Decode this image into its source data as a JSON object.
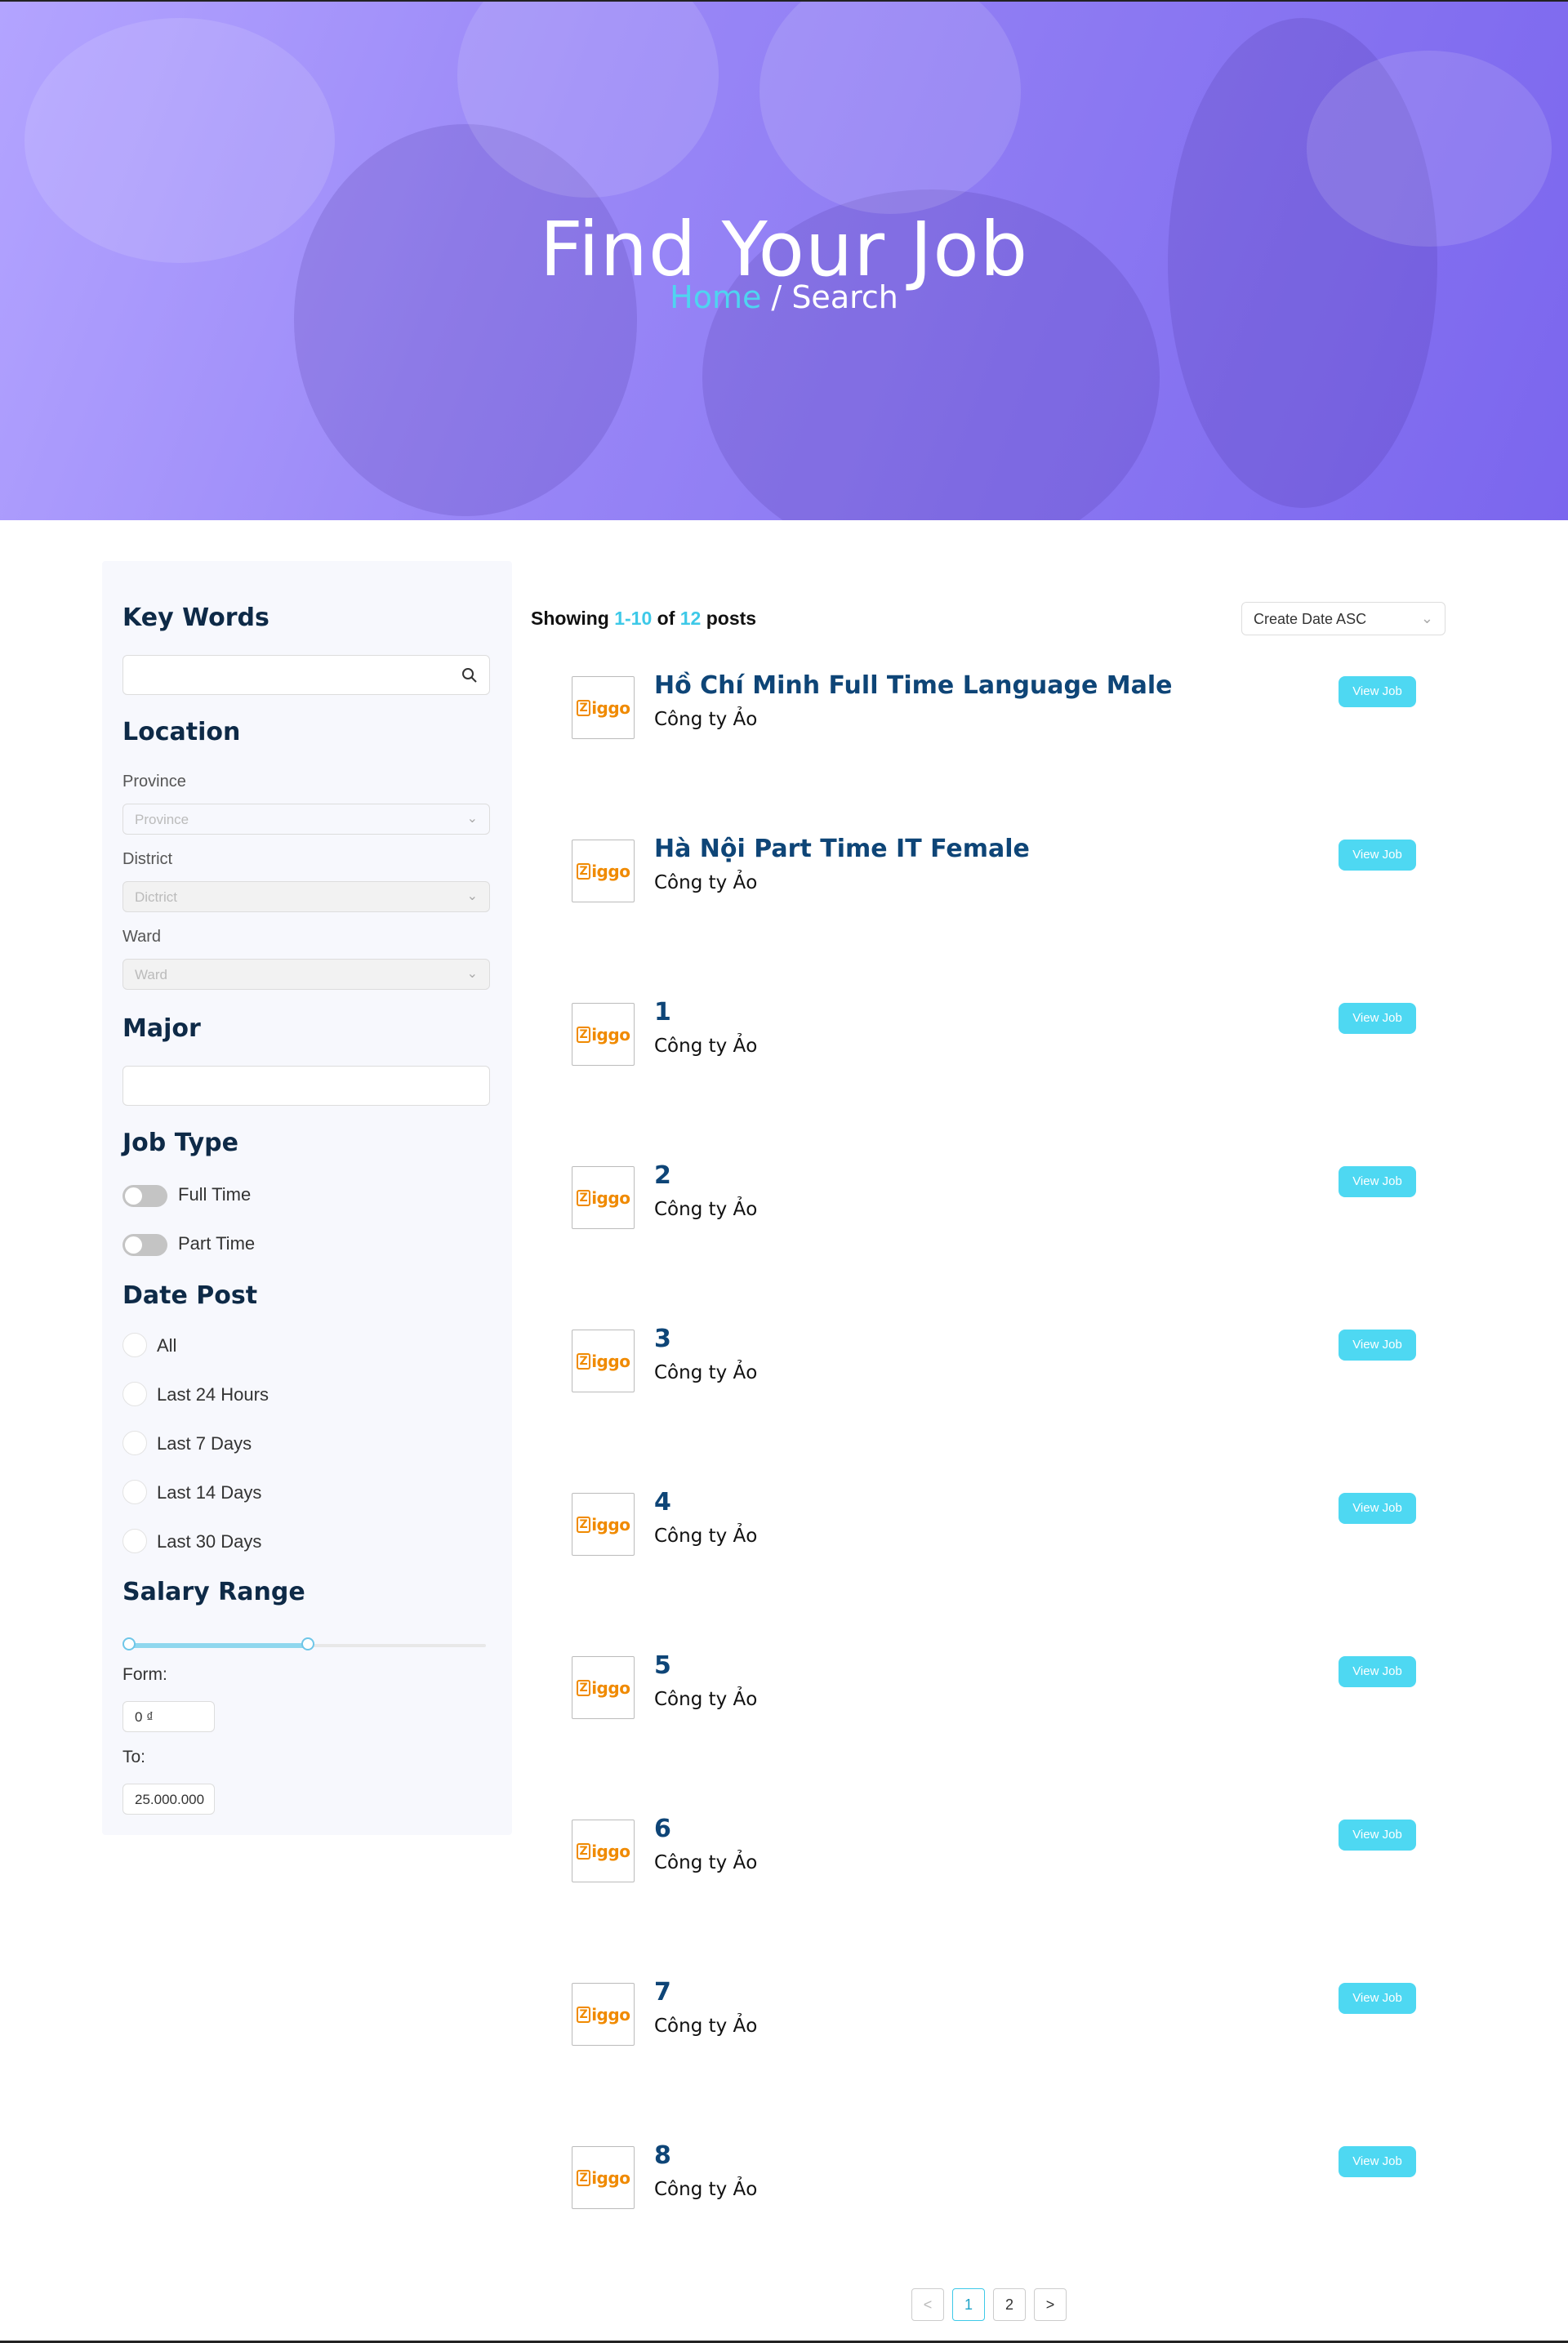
{
  "hero": {
    "title": "Find Your Job",
    "breadcrumb_home": "Home",
    "breadcrumb_sep": " / ",
    "breadcrumb_current": "Search"
  },
  "sidebar": {
    "keywords": {
      "heading": "Key Words",
      "value": "",
      "placeholder": ""
    },
    "location": {
      "heading": "Location",
      "province": {
        "label": "Province",
        "placeholder": "Province"
      },
      "district": {
        "label": "District",
        "placeholder": "Dictrict"
      },
      "ward": {
        "label": "Ward",
        "placeholder": "Ward"
      }
    },
    "major": {
      "heading": "Major",
      "value": ""
    },
    "job_type": {
      "heading": "Job Type",
      "options": [
        {
          "label": "Full Time",
          "on": false
        },
        {
          "label": "Part Time",
          "on": false
        }
      ]
    },
    "date_post": {
      "heading": "Date Post",
      "options": [
        "All",
        "Last 24 Hours",
        "Last 7 Days",
        "Last 14 Days",
        "Last 30 Days"
      ]
    },
    "salary": {
      "heading": "Salary Range",
      "from_label": "Form:",
      "from_value": "0 ₫",
      "to_label": "To:",
      "to_value": "25.000.000",
      "slider_low_fraction": 0,
      "slider_high_fraction": 0.5
    }
  },
  "results": {
    "showing_prefix": "Showing ",
    "range": "1-10",
    "of": " of ",
    "total": "12",
    "suffix": " posts",
    "sort": {
      "selected": "Create Date ASC"
    },
    "jobs": [
      {
        "title": "Hồ Chí Minh Full Time Language Male",
        "company": "Công ty Ảo",
        "button": "View Job"
      },
      {
        "title": "Hà Nội Part Time IT Female",
        "company": "Công ty Ảo",
        "button": "View Job"
      },
      {
        "title": "1",
        "company": "Công ty Ảo",
        "button": "View Job"
      },
      {
        "title": "2",
        "company": "Công ty Ảo",
        "button": "View Job"
      },
      {
        "title": "3",
        "company": "Công ty Ảo",
        "button": "View Job"
      },
      {
        "title": "4",
        "company": "Công ty Ảo",
        "button": "View Job"
      },
      {
        "title": "5",
        "company": "Công ty Ảo",
        "button": "View Job"
      },
      {
        "title": "6",
        "company": "Công ty Ảo",
        "button": "View Job"
      },
      {
        "title": "7",
        "company": "Công ty Ảo",
        "button": "View Job"
      },
      {
        "title": "8",
        "company": "Công ty Ảo",
        "button": "View Job"
      }
    ],
    "logo_text": "iggo"
  },
  "pagination": {
    "prev": "<",
    "pages": [
      "1",
      "2"
    ],
    "next": ">",
    "current": "1"
  },
  "colors": {
    "accent": "#4ed8f2",
    "title_blue": "#0e4577",
    "hero": "#8b78f2"
  }
}
